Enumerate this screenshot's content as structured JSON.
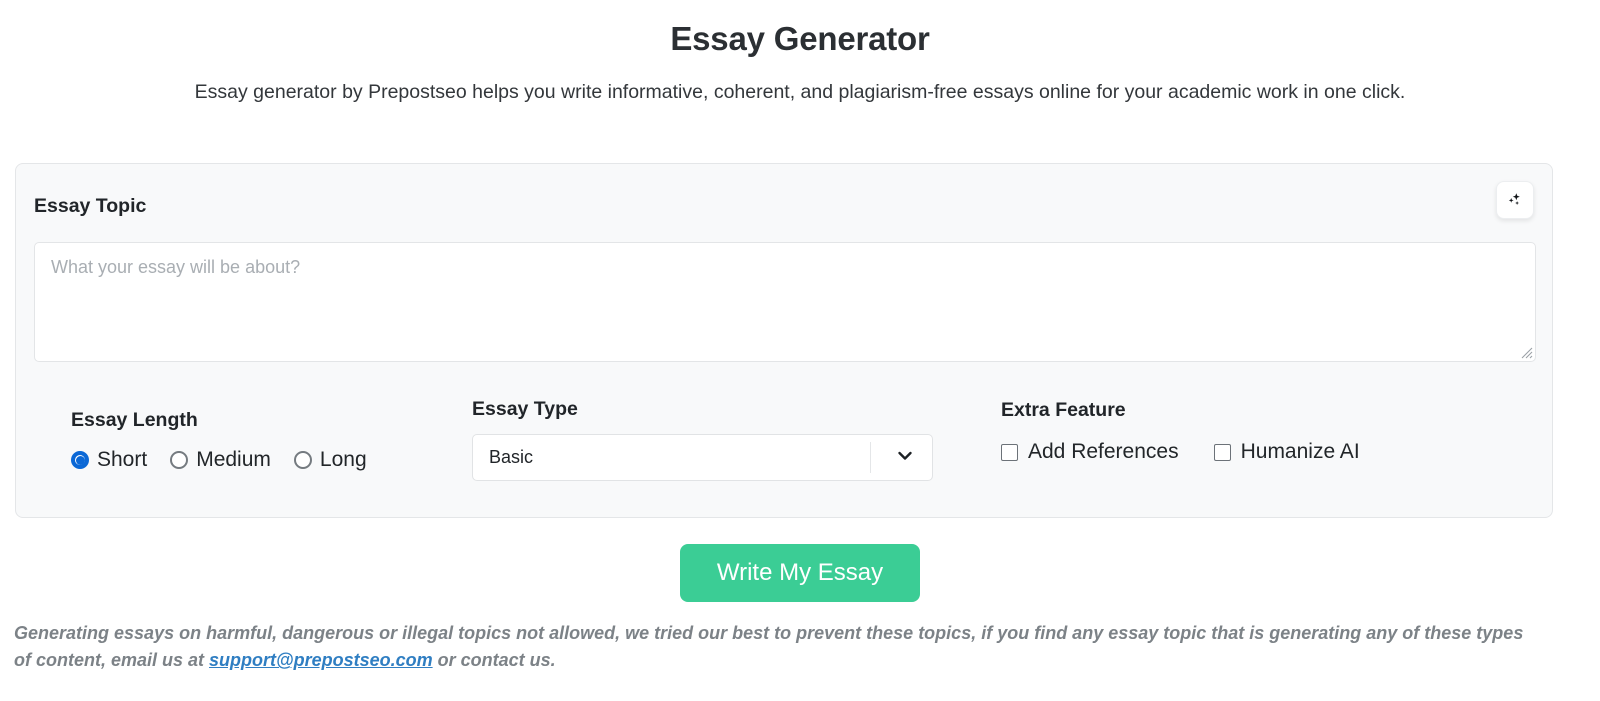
{
  "header": {
    "title": "Essay Generator",
    "subtitle": "Essay generator by Prepostseo helps you write informative, coherent, and plagiarism-free essays online for your academic work in one click."
  },
  "card": {
    "topic_label": "Essay Topic",
    "ai_button_icon": "sparkles-icon",
    "topic_input": {
      "value": "",
      "placeholder": "What your essay will be about?"
    }
  },
  "options": {
    "essay_length": {
      "title": "Essay Length",
      "selected": "Short",
      "choices": [
        {
          "label": "Short",
          "checked": true
        },
        {
          "label": "Medium",
          "checked": false
        },
        {
          "label": "Long",
          "checked": false
        }
      ]
    },
    "essay_type": {
      "title": "Essay Type",
      "selected": "Basic",
      "chevron_icon": "chevron-down-icon"
    },
    "extra_feature": {
      "title": "Extra Feature",
      "choices": [
        {
          "label": "Add References",
          "checked": false
        },
        {
          "label": "Humanize AI",
          "checked": false
        }
      ]
    }
  },
  "submit": {
    "label": "Write My Essay",
    "color": "#3bcd95"
  },
  "disclaimer": {
    "part1": "Generating essays on harmful, dangerous or illegal topics not allowed, we tried our best to prevent these topics, if you find any essay topic that is generating any of these types of content, email us at ",
    "email": "support@prepostseo.com",
    "part2": " or contact us.",
    "link_color": "#2f7ec2"
  }
}
